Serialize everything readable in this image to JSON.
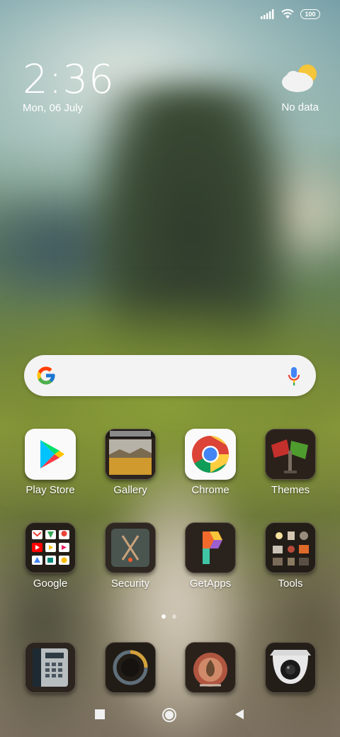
{
  "status": {
    "battery": "100"
  },
  "clock": {
    "time": "2:36",
    "date": "Mon, 06 July"
  },
  "weather": {
    "text": "No data",
    "icon": "partly-cloudy-icon"
  },
  "search": {
    "icons": [
      "google-g-icon",
      "microphone-icon"
    ]
  },
  "apps_row1": [
    {
      "label": "Play Store",
      "icon": "play-store-icon"
    },
    {
      "label": "Gallery",
      "icon": "gallery-icon"
    },
    {
      "label": "Chrome",
      "icon": "chrome-icon"
    },
    {
      "label": "Themes",
      "icon": "themes-flags-icon"
    }
  ],
  "apps_row2": [
    {
      "label": "Google",
      "icon": "google-folder-icon"
    },
    {
      "label": "Security",
      "icon": "security-icon"
    },
    {
      "label": "GetApps",
      "icon": "getapps-icon"
    },
    {
      "label": "Tools",
      "icon": "tools-folder-icon"
    }
  ],
  "dock": [
    {
      "icon": "phone-icon"
    },
    {
      "icon": "messaging-icon"
    },
    {
      "icon": "camera-icon"
    },
    {
      "icon": "webcam-browser-icon"
    }
  ],
  "pager": {
    "pages": 2,
    "current": 1
  },
  "nav": [
    "recents-square-icon",
    "home-circle-icon",
    "back-triangle-icon"
  ],
  "colors": {
    "google_blue": "#4285F4",
    "google_red": "#EA4335",
    "google_yellow": "#FBBC05",
    "google_green": "#34A853"
  }
}
